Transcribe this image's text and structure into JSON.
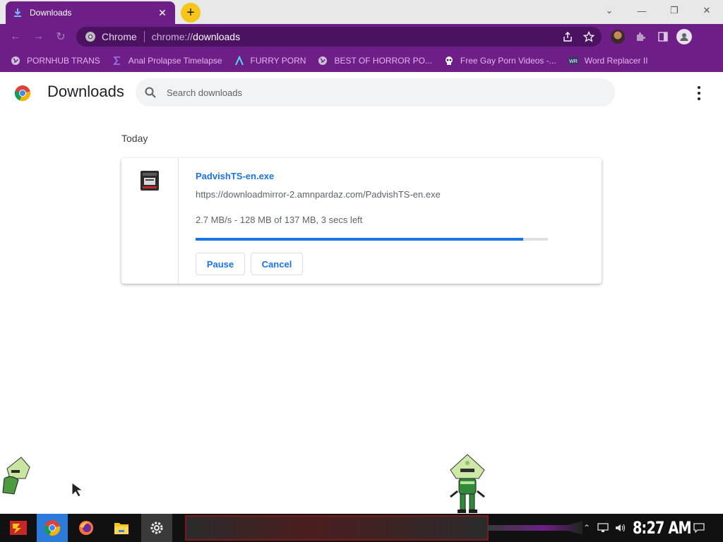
{
  "browser": {
    "tab": {
      "title": "Downloads"
    },
    "window_controls": {
      "minimize": "—",
      "restore": "❐",
      "close": "✕",
      "tab_search": "⌄"
    },
    "omnibox": {
      "scheme_label": "Chrome",
      "url_prefix": "chrome://",
      "url_host": "downloads"
    },
    "bookmarks": [
      {
        "label": "PORNHUB TRANS",
        "icon": "globe-icon"
      },
      {
        "label": "Anal Prolapse Timelapse",
        "icon": "sigma-icon"
      },
      {
        "label": "FURRY PORN",
        "icon": "lambda-icon"
      },
      {
        "label": "BEST OF HORROR PO...",
        "icon": "globe-icon"
      },
      {
        "label": "Free Gay Porn Videos -...",
        "icon": "skull-icon"
      },
      {
        "label": "Word Replacer II",
        "icon": "wr-icon"
      }
    ]
  },
  "page": {
    "title": "Downloads",
    "search": {
      "placeholder": "Search downloads"
    }
  },
  "downloads": {
    "date_heading": "Today",
    "items": [
      {
        "file_name": "PadvishTS-en.exe",
        "url": "https://downloadmirror-2.amnpardaz.com/PadvishTS-en.exe",
        "status": "2.7 MB/s - 128 MB of 137 MB, 3 secs left",
        "progress_fraction": 0.93,
        "pause_label": "Pause",
        "cancel_label": "Cancel"
      }
    ]
  },
  "taskbar": {
    "clock": "8:27 AM"
  },
  "colors": {
    "browser_frame": "#6e1f87",
    "omnibox_bg": "#4a1260",
    "bookmark_text": "#e6b3f0",
    "link_blue": "#1a73e8",
    "tab_add_button": "#f5c518"
  }
}
